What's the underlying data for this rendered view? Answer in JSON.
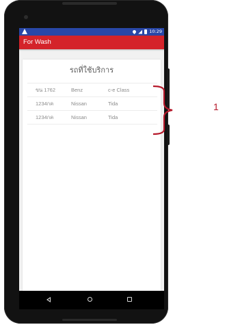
{
  "status_bar": {
    "time": "10:29",
    "icons": [
      "notification-triangle-icon",
      "location-icon",
      "signal-icon",
      "battery-icon"
    ]
  },
  "app_bar": {
    "title": "For Wash",
    "color": "#d4232a"
  },
  "main": {
    "title": "รถที่ใช้บริการ",
    "cars": [
      {
        "plate": "ขน 1762",
        "brand": "Benz",
        "model": "c-e Class"
      },
      {
        "plate": "1234กค",
        "brand": "Nissan",
        "model": "Tida"
      },
      {
        "plate": "1234กค",
        "brand": "Nissan",
        "model": "Tida"
      }
    ]
  },
  "nav_bar": {
    "icons": [
      "back-icon",
      "home-icon",
      "recents-icon"
    ]
  },
  "annotation": {
    "label": "1",
    "color": "#b5182a"
  },
  "colors": {
    "status_bar": "#2947a8",
    "app_bar": "#d4232a",
    "background": "#f1f1f1"
  }
}
